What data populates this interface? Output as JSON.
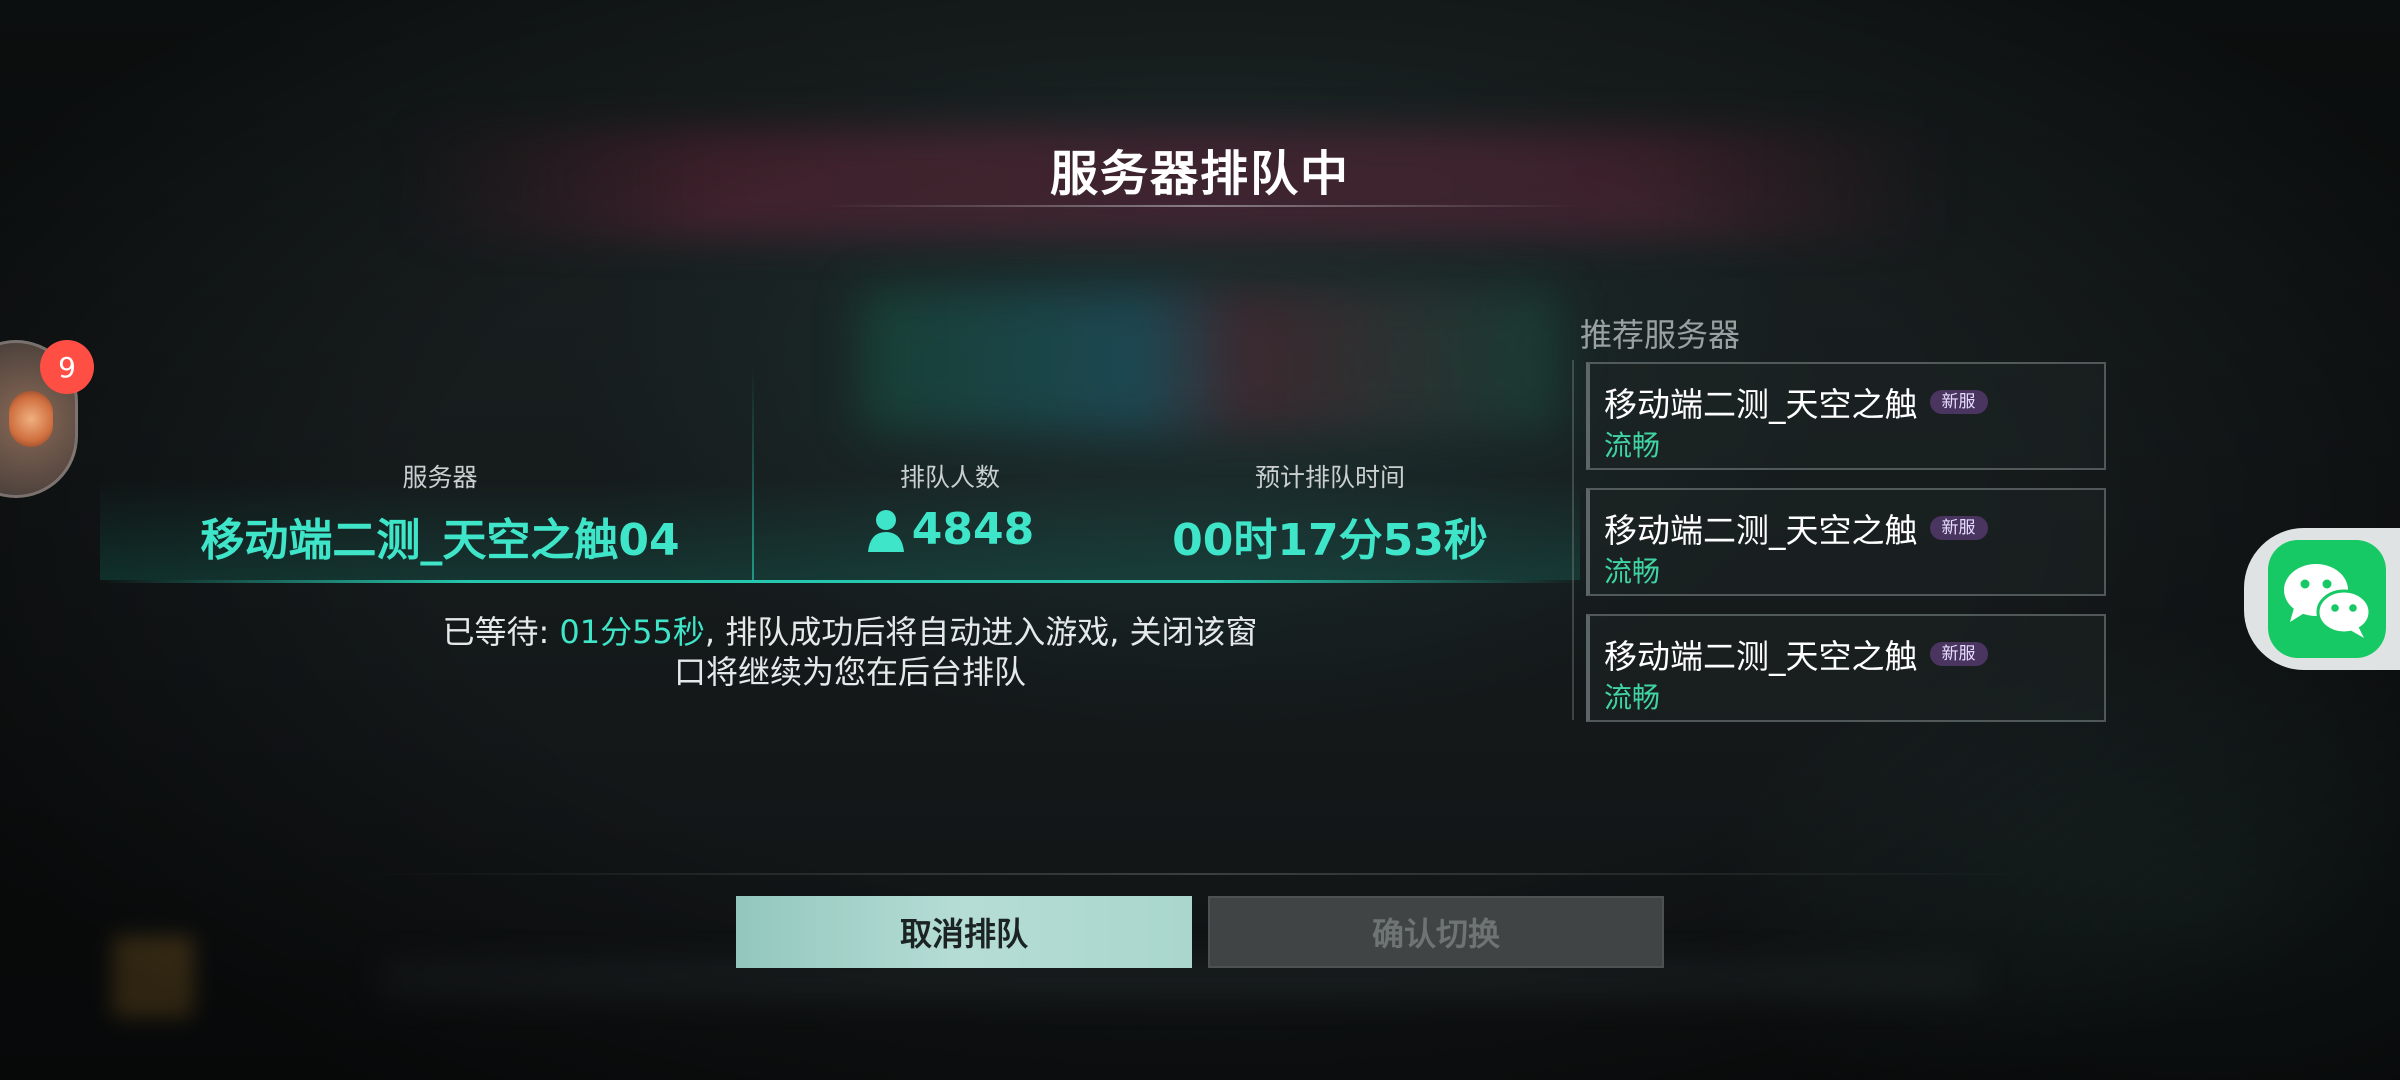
{
  "title": "服务器排队中",
  "queue_info": {
    "server_label": "服务器",
    "server_value": "移动端二测_天空之触04",
    "count_label": "排队人数",
    "count_value": "4848",
    "count_icon": "person-icon",
    "time_label": "预计排队时间",
    "time_value": "00时17分53秒"
  },
  "wait_message": {
    "prefix": "已等待: ",
    "elapsed": "01分55秒",
    "line1_rest": ", 排队成功后将自动进入游戏, 关闭该窗",
    "line2": "口将继续为您在后台排队"
  },
  "recommend": {
    "title": "推荐服务器",
    "servers": [
      {
        "name": "移动端二测_天空之触",
        "badge": "新服",
        "status": "流畅"
      },
      {
        "name": "移动端二测_天空之触",
        "badge": "新服",
        "status": "流畅"
      },
      {
        "name": "移动端二测_天空之触",
        "badge": "新服",
        "status": "流畅"
      }
    ]
  },
  "buttons": {
    "cancel": "取消排队",
    "confirm": "确认切换"
  },
  "avatar_badge": "9",
  "colors": {
    "accent": "#3fe5c8",
    "status_green": "#3fd4a2",
    "badge_red": "#ff4f45",
    "wechat_green": "#17c964"
  }
}
